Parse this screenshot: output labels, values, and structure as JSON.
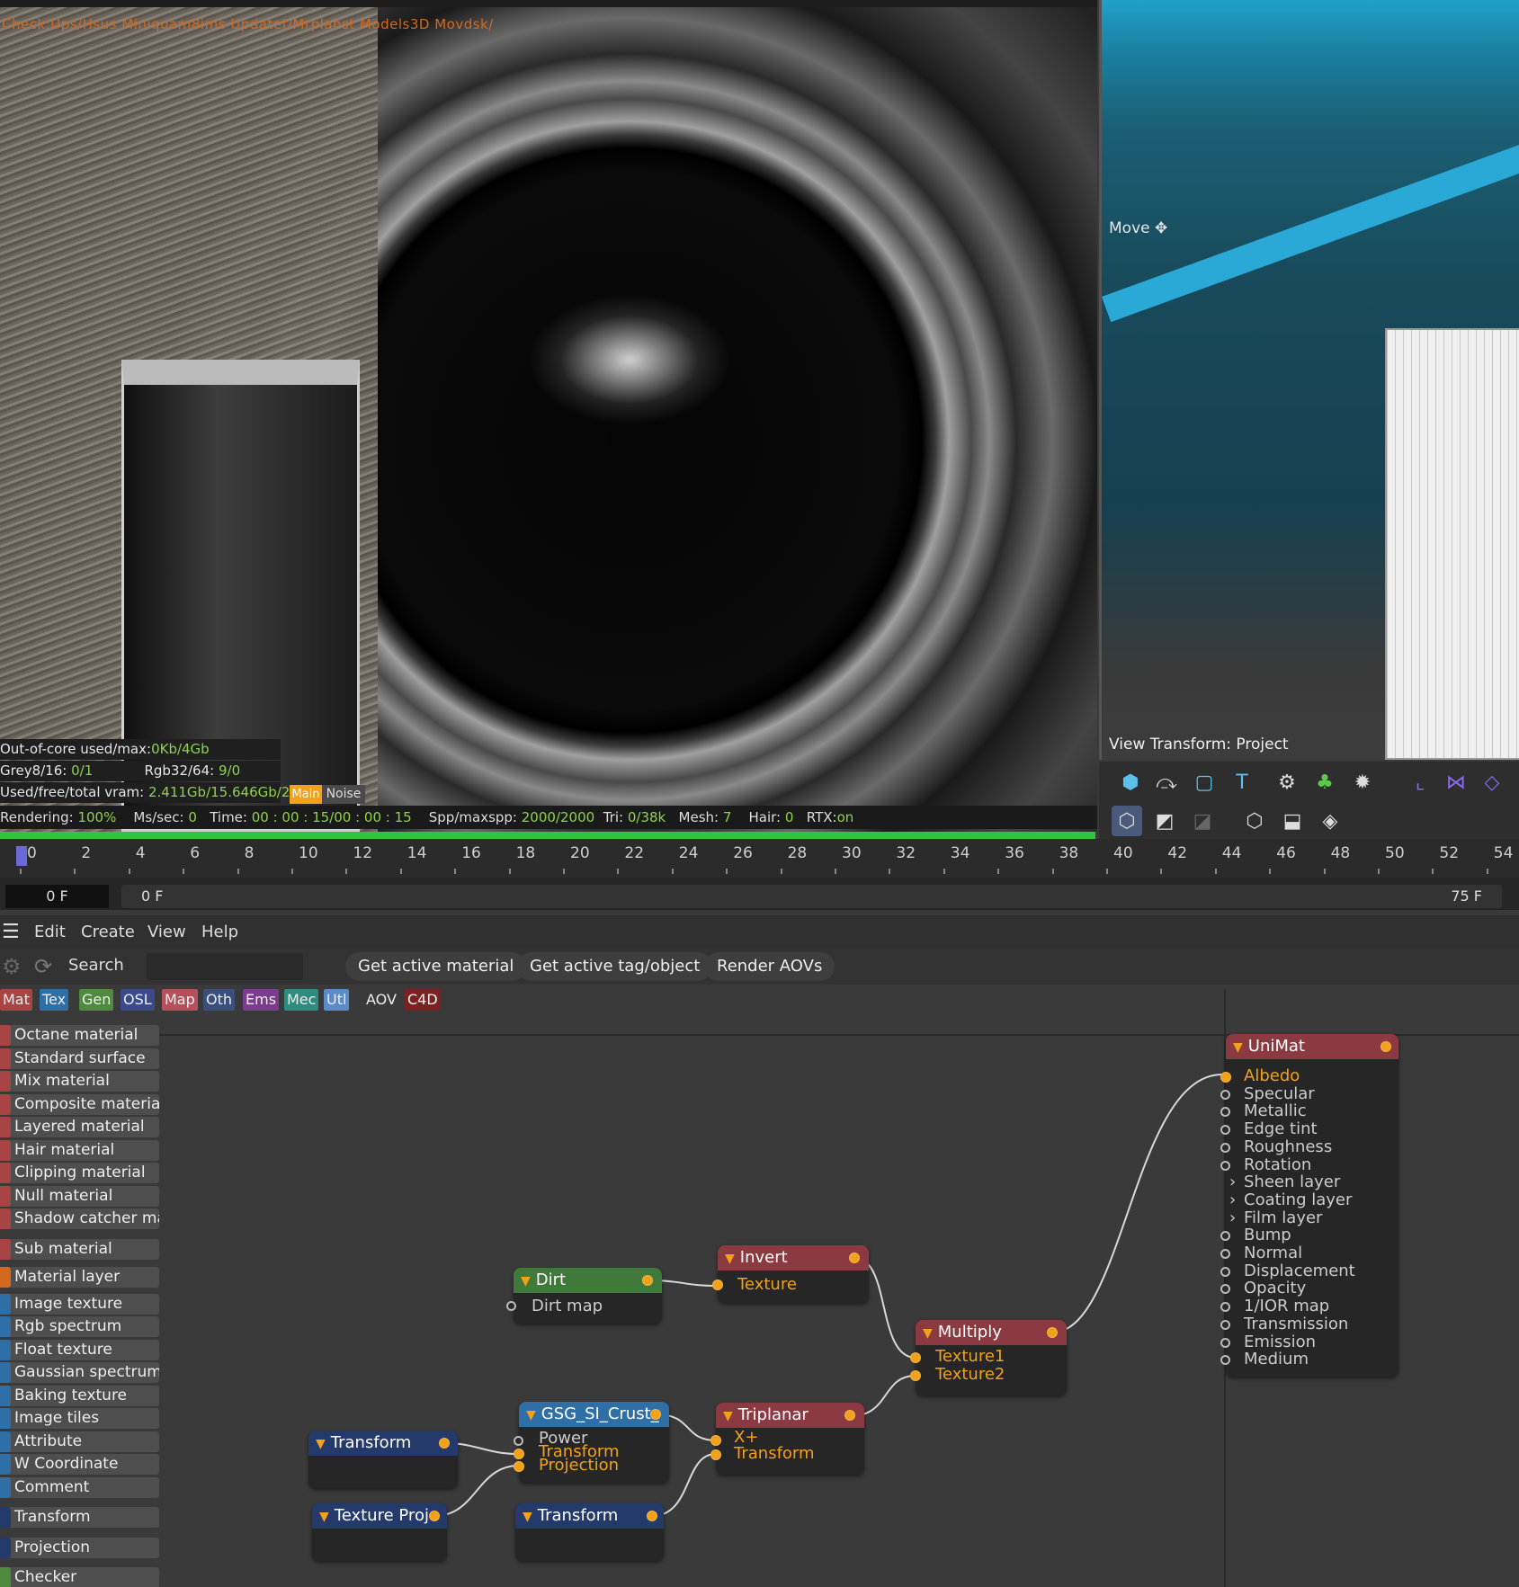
{
  "render_view": {
    "path_text": "Check:Ups/Hsus Miniquam8ims Updatet/Mrplanst Models3D Movdsk/",
    "out_of_core_label": "Out-of-core used/max:",
    "out_of_core_value": "0Kb/4Gb",
    "grey_label": "Grey8/16:",
    "grey_value": "0/1",
    "rgb_label": "Rgb32/64:",
    "rgb_value": "9/0",
    "vram_label": "Used/free/total vram:",
    "vram_value": "2.411Gb/15.646Gb/2",
    "main_button": "Main",
    "noise_button": "Noise",
    "status": {
      "rendering_label": "Rendering:",
      "rendering_value": "100%",
      "mssec_label": "Ms/sec:",
      "mssec_value": "0",
      "time_label": "Time:",
      "time_value": "00 : 00 : 15/00 : 00 : 15",
      "spp_label": "Spp/maxspp:",
      "spp_value": "2000/2000",
      "tri_label": "Tri:",
      "tri_value": "0/38k",
      "mesh_label": "Mesh:",
      "mesh_value": "7",
      "hair_label": "Hair:",
      "hair_value": "0",
      "rtx_label": "RTX:",
      "rtx_value": "on"
    },
    "progress": 1.0
  },
  "viewport3d": {
    "move_label": "Move",
    "view_transform": "View Transform: Project"
  },
  "toolbar_icons": [
    "cube-icon",
    "bend-icon",
    "square-icon",
    "text-icon",
    "camera-gear-icon",
    "green-cubes-icon",
    "gear-light-icon",
    "axis-icon",
    "mirror-icon",
    "shape-icon",
    "shaded-cube-icon",
    "wire-cube-icon",
    "grey-square-icon",
    "hexagon-icon",
    "cube-half-icon",
    "cube-outline-icon"
  ],
  "timeline": {
    "ticks": [
      "0",
      "2",
      "4",
      "6",
      "8",
      "10",
      "12",
      "14",
      "16",
      "18",
      "20",
      "22",
      "24",
      "26",
      "28",
      "30",
      "32",
      "34",
      "36",
      "38",
      "40",
      "42",
      "44",
      "46",
      "48",
      "50",
      "52",
      "54"
    ],
    "current_frame": "0 F",
    "start_frame": "0 F",
    "end_frame": "75 F"
  },
  "menu": {
    "items": [
      "Edit",
      "Create",
      "View",
      "Help"
    ]
  },
  "searchbar": {
    "search_label": "Search",
    "buttons": [
      "Get active material",
      "Get active tag/object",
      "Render AOVs"
    ]
  },
  "categories": [
    {
      "label": "Mat",
      "color": "#a94444"
    },
    {
      "label": "Tex",
      "color": "#2f6fa8"
    },
    {
      "label": "Gen",
      "color": "#4f8a3e"
    },
    {
      "label": "OSL",
      "color": "#3c4a8c"
    },
    {
      "label": "Map",
      "color": "#b4505a"
    },
    {
      "label": "Oth",
      "color": "#3a4f7a"
    },
    {
      "label": "Ems",
      "color": "#7a3c8c"
    },
    {
      "label": "Mec",
      "color": "#2f8a80"
    },
    {
      "label": "Utl",
      "color": "#5a8ac8"
    },
    {
      "label": "AOV",
      "color": "#3a3a3a"
    },
    {
      "label": "C4D",
      "color": "#7a2222"
    }
  ],
  "library": [
    {
      "label": "Octane material",
      "color": "#a94444"
    },
    {
      "label": "Standard surface",
      "color": "#a94444"
    },
    {
      "label": "Mix material",
      "color": "#a94444"
    },
    {
      "label": "Composite material",
      "color": "#a94444"
    },
    {
      "label": "Layered material",
      "color": "#a94444"
    },
    {
      "label": "Hair material",
      "color": "#a94444"
    },
    {
      "label": "Clipping material",
      "color": "#a94444"
    },
    {
      "label": "Null material",
      "color": "#a94444"
    },
    {
      "label": "Shadow catcher mat",
      "color": "#a94444"
    },
    {
      "label": "Sub material",
      "color": "#a94444"
    },
    {
      "label": "Material layer",
      "color": "#d2691e"
    },
    {
      "label": "Image texture",
      "color": "#2f6fa8"
    },
    {
      "label": "Rgb spectrum",
      "color": "#2f6fa8"
    },
    {
      "label": "Float texture",
      "color": "#2f6fa8"
    },
    {
      "label": "Gaussian spectrum",
      "color": "#2f6fa8"
    },
    {
      "label": "Baking texture",
      "color": "#2f6fa8"
    },
    {
      "label": "Image tiles",
      "color": "#2f6fa8"
    },
    {
      "label": "Attribute",
      "color": "#2f6fa8"
    },
    {
      "label": "W Coordinate",
      "color": "#2f6fa8"
    },
    {
      "label": "Comment",
      "color": "#2f6fa8"
    },
    {
      "label": "Transform",
      "color": "#233a6a"
    },
    {
      "label": "Projection",
      "color": "#233a6a"
    },
    {
      "label": "Checker",
      "color": "#4f8a3e"
    }
  ],
  "nodes": {
    "unimat": {
      "title": "UniMat",
      "color": "#8c3a42",
      "ports": [
        "Albedo",
        "Specular",
        "Metallic",
        "Edge tint",
        "Roughness",
        "Rotation",
        "Sheen layer",
        "Coating layer",
        "Film layer",
        "Bump",
        "Normal",
        "Displacement",
        "Opacity",
        "1/IOR map",
        "Transmission",
        "Emission",
        "Medium"
      ]
    },
    "dirt": {
      "title": "Dirt",
      "color": "#3f7a3a",
      "ports": [
        "Dirt map"
      ]
    },
    "invert": {
      "title": "Invert",
      "color": "#8c3a42",
      "ports": [
        "Texture"
      ]
    },
    "multiply": {
      "title": "Multiply",
      "color": "#8c3a42",
      "ports": [
        "Texture1",
        "Texture2"
      ]
    },
    "gsg": {
      "title": "GSG_SI_Crust_",
      "color": "#2f6fa8",
      "ports": [
        "Power",
        "Transform",
        "Projection"
      ]
    },
    "triplanar": {
      "title": "Triplanar",
      "color": "#8c3a42",
      "ports": [
        "X+",
        "Transform"
      ]
    },
    "transform1": {
      "title": "Transform",
      "color": "#233a6a"
    },
    "transform2": {
      "title": "Transform",
      "color": "#233a6a"
    },
    "texproj": {
      "title": "Texture Proj",
      "color": "#233a6a"
    }
  }
}
